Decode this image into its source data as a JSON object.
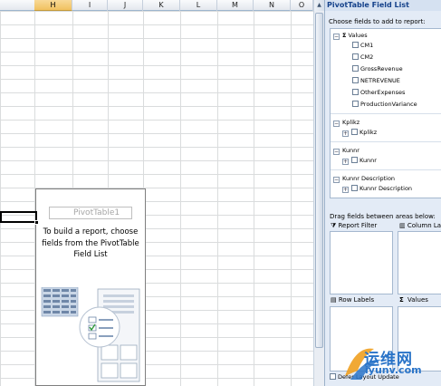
{
  "sheet": {
    "columns": [
      "H",
      "I",
      "J",
      "K",
      "L",
      "M",
      "N",
      "O"
    ],
    "active_column": "H"
  },
  "pivot_placeholder": {
    "name": "PivotTable1",
    "instructions": "To build a report, choose fields from the PivotTable Field List"
  },
  "field_list": {
    "title": "PivotTable Field List",
    "subtitle": "Choose fields to add to report:",
    "values_group": "Values",
    "values_fields": [
      "CM1",
      "CM2",
      "GrossRevenue",
      "NETREVENUE",
      "OtherExpenses",
      "ProductionVariance"
    ],
    "dimensions": [
      {
        "group": "Kplikz",
        "field": "Kplikz"
      },
      {
        "group": "Kunnr",
        "field": "Kunnr"
      },
      {
        "group": "Kunnr Description",
        "field": "Kunnr Description"
      }
    ],
    "drag_label": "Drag fields between areas below:",
    "areas": {
      "report_filter": "Report Filter",
      "column_labels": "Column La",
      "row_labels": "Row Labels",
      "values": "Values"
    },
    "defer": "Defer Layout Update"
  },
  "watermark": {
    "text": "运维网",
    "url": "iyunv.com"
  }
}
